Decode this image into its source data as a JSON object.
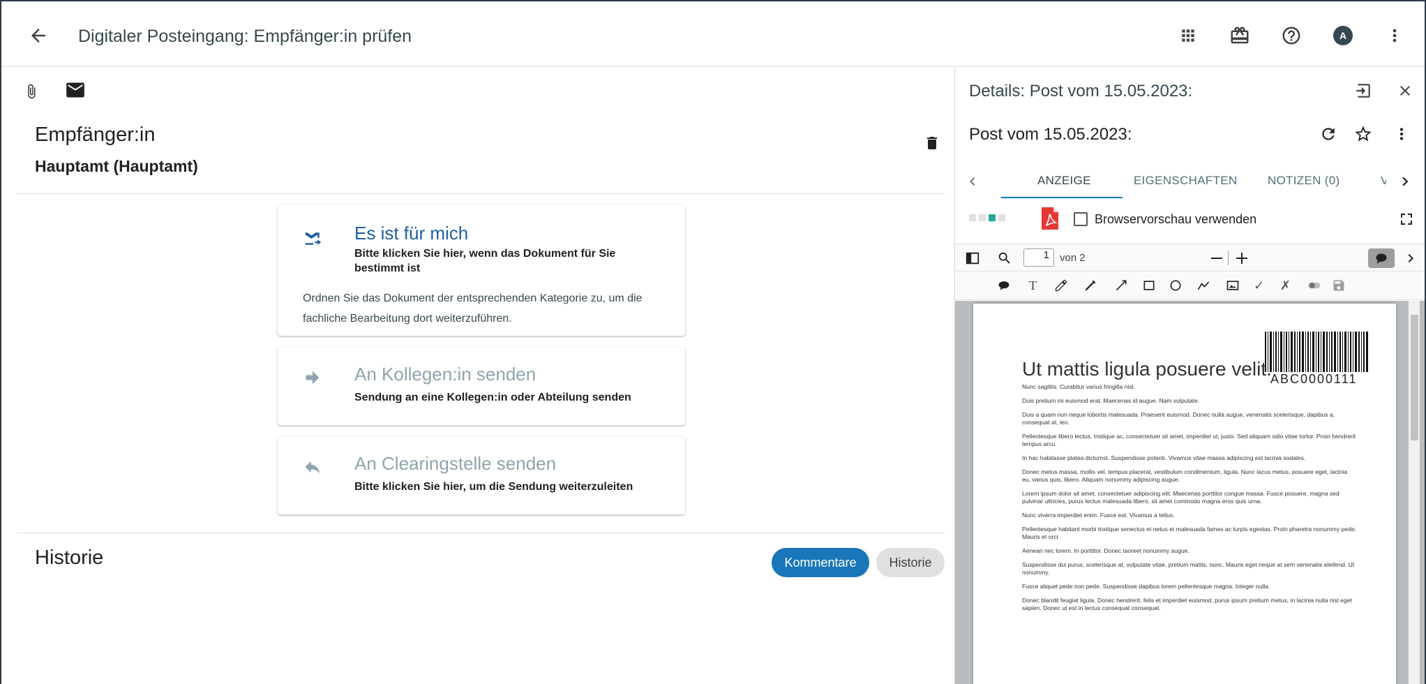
{
  "header": {
    "title": "Digitaler Posteingang: Empfänger:in prüfen",
    "avatar_initial": "A"
  },
  "left": {
    "recipient_heading": "Empfänger:in",
    "recipient_value": "Hauptamt (Hauptamt)",
    "cards": [
      {
        "title": "Es ist für mich",
        "subtitle": "Bitte klicken Sie hier, wenn das Dokument für Sie bestimmt ist",
        "description": "Ordnen Sie das Dokument der entsprechenden Kategorie zu, um die fachliche Bearbeitung dort weiterzuführen."
      },
      {
        "title": "An Kollegen:in senden",
        "subtitle": "Sendung an eine Kollegen:in oder Abteilung senden"
      },
      {
        "title": "An Clearingstelle senden",
        "subtitle": "Bitte klicken Sie hier, um die Sendung weiterzuleiten"
      }
    ],
    "history_heading": "Historie",
    "chips": {
      "comments": "Kommentare",
      "history": "Historie"
    }
  },
  "right": {
    "details_title": "Details: Post vom 15.05.2023:",
    "post_title": "Post vom 15.05.2023:",
    "tabs": [
      "ANZEIGE",
      "EIGENSCHAFTEN",
      "NOTIZEN (0)",
      "V"
    ],
    "active_tab": "ANZEIGE",
    "browser_preview_label": "Browservorschau verwenden",
    "page_current": "1",
    "page_of": "von 2",
    "document": {
      "heading": "Ut mattis ligula posuere velit.",
      "barcode_label": "ABC0000111",
      "paragraphs": [
        "Nunc sagittis. Curabitur varius fringilla nisl.",
        "Duis pretium mi euismod erat. Maecenas id augue. Nam vulputate.",
        "Duis a quam non neque lobortis malesuada. Praesent euismod. Donec nulla augue, venenatis scelerisque, dapibus a, consequat at, leo.",
        "Pellentesque libero lectus, tristique ac, consectetuer sit amet, imperdiet ut, justo. Sed aliquam odio vitae tortor. Proin hendrerit tempus arcu.",
        "In hac habitasse platea dictumst. Suspendisse potenti. Vivamus vitae massa adipiscing est lacinia sodales.",
        "Donec metus massa, mollis vel, tempus placerat, vestibulum condimentum, ligula. Nunc lacus metus, posuere eget, lacinia eu, varius quis, libero. Aliquam nonummy adipiscing augue.",
        "Lorem ipsum dolor sit amet, consectetuer adipiscing elit. Maecenas porttitor congue massa. Fusce posuere, magna sed pulvinar ultricies, purus lectus malesuada libero, sit amet commodo magna eros quis urna.",
        "Nunc viverra imperdiet enim. Fusce est. Vivamus a tellus.",
        "Pellentesque habitant morbi tristique senectus et netus et malesuada fames ac turpis egestas. Proin pharetra nonummy pede. Mauris et orci.",
        "Aenean nec lorem. In porttitor. Donec laoreet nonummy augue.",
        "Suspendisse dui purus, scelerisque at, vulputate vitae, pretium mattis, nunc. Mauris eget neque at sem venenatis eleifend. Ut nonummy.",
        "Fusce aliquet pede non pede. Suspendisse dapibus lorem pellentesque magna. Integer nulla.",
        "Donec blandit feugiat ligula. Donec hendrerit, felis et imperdiet euismod, purus ipsum pretium metus, in lacinia nulla nisl eget sapien. Donec ut est in lectus consequat consequat."
      ]
    }
  },
  "colors": {
    "accent": "#1976b8",
    "card_title_active": "#1e5f9e",
    "card_title_muted": "#90a4ae",
    "pdf_red": "#e53935",
    "teal": "#26a69a"
  },
  "icons": [
    "arrow-back-icon",
    "apps-grid-icon",
    "gift-icon",
    "help-icon",
    "more-vert-icon",
    "paperclip-icon",
    "mail-icon",
    "trash-icon",
    "mail-forward-icon",
    "arrow-right-icon",
    "reply-icon",
    "exit-panel-icon",
    "close-icon",
    "refresh-icon",
    "star-icon",
    "chevron-left-icon",
    "chevron-right-icon",
    "pdf-icon",
    "fullscreen-icon",
    "sidebar-toggle-icon",
    "search-icon",
    "minus-icon",
    "plus-icon",
    "comment-icon"
  ]
}
